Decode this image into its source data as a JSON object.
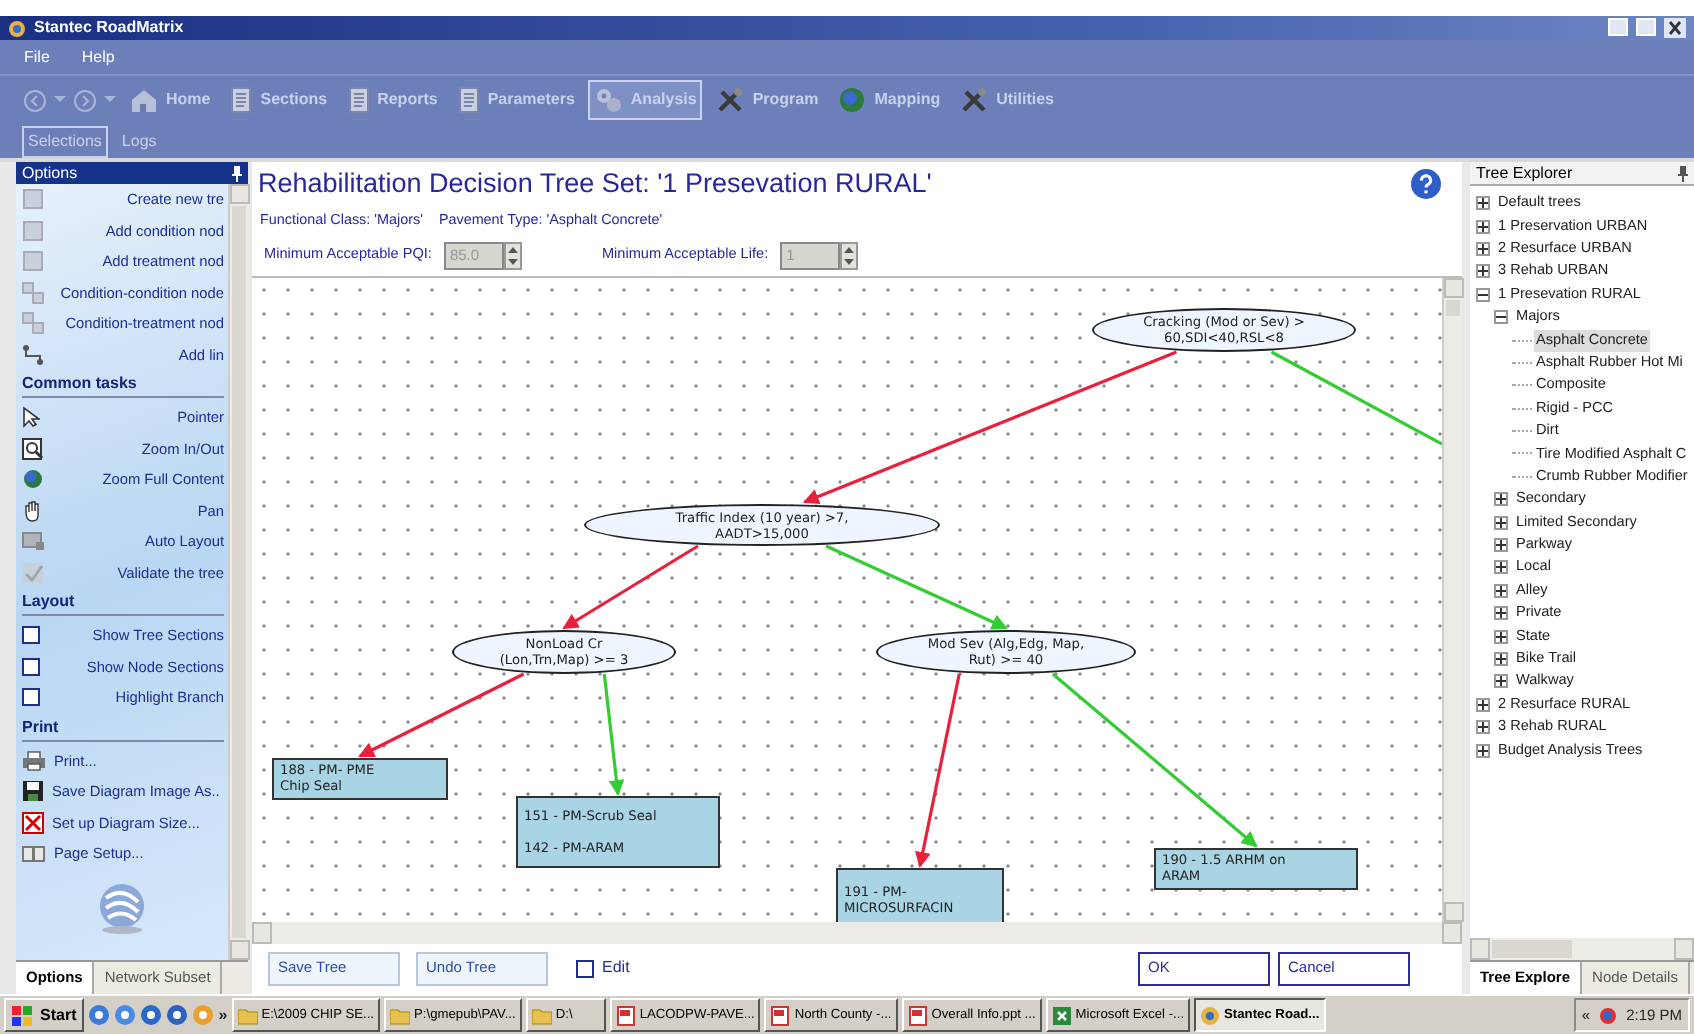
{
  "window": {
    "title": "Stantec RoadMatrix"
  },
  "menu": [
    "File",
    "Help"
  ],
  "toolbar": [
    {
      "label": "Home",
      "kind": "house",
      "selected": false
    },
    {
      "label": "Sections",
      "kind": "doc",
      "selected": false
    },
    {
      "label": "Reports",
      "kind": "doc",
      "selected": false
    },
    {
      "label": "Parameters",
      "kind": "doc",
      "selected": false
    },
    {
      "label": "Analysis",
      "kind": "gears",
      "selected": true
    },
    {
      "label": "Program",
      "kind": "tools",
      "selected": false
    },
    {
      "label": "Mapping",
      "kind": "globe",
      "selected": false
    },
    {
      "label": "Utilities",
      "kind": "tools",
      "selected": false
    }
  ],
  "subtabs": [
    {
      "label": "Selections",
      "selected": true
    },
    {
      "label": "Logs",
      "selected": false
    }
  ],
  "options_panel": {
    "title": "Options",
    "sections": [
      {
        "items": [
          {
            "label": "Create new tre",
            "kind": "tool"
          },
          {
            "label": "Add condition nod",
            "kind": "tool"
          },
          {
            "label": "Add  treatment  nod",
            "kind": "tool"
          },
          {
            "label": "Condition-condition node",
            "kind": "tool"
          },
          {
            "label": "Condition-treatment nod",
            "kind": "tool"
          },
          {
            "label": "Add lin",
            "kind": "tool"
          }
        ]
      },
      {
        "heading": "Common tasks",
        "items": [
          {
            "label": "Pointer",
            "kind": "tool"
          },
          {
            "label": "Zoom In/Out",
            "kind": "tool"
          },
          {
            "label": "Zoom Full Content",
            "kind": "tool"
          },
          {
            "label": "Pan",
            "kind": "tool"
          },
          {
            "label": "Auto Layout",
            "kind": "tool"
          },
          {
            "label": "Validate the tree",
            "kind": "tool"
          }
        ]
      },
      {
        "heading": "Layout",
        "items": [
          {
            "label": "Show Tree Sections",
            "kind": "checkbox",
            "checked": false
          },
          {
            "label": "Show Node  Sections",
            "kind": "checkbox",
            "checked": false
          },
          {
            "label": "Highlight Branch",
            "kind": "checkbox",
            "checked": false
          }
        ]
      },
      {
        "heading": "Print",
        "items": [
          {
            "label": "Print...",
            "kind": "action"
          },
          {
            "label": "Save Diagram Image As..",
            "kind": "action"
          },
          {
            "label": "Set up Diagram Size...",
            "kind": "action"
          },
          {
            "label": "Page Setup...",
            "kind": "action"
          }
        ]
      }
    ]
  },
  "left_tabs": [
    {
      "label": "Options",
      "selected": true
    },
    {
      "label": "Network Subset",
      "selected": false
    }
  ],
  "editor": {
    "heading": "Rehabilitation Decision Tree Set: '1 Presevation RURAL'",
    "functional_class": "Functional Class: 'Majors'",
    "pavement_type": "Pavement Type: 'Asphalt Concrete'",
    "fields": [
      {
        "label": "Minimum Acceptable PQI:",
        "value": "85.0",
        "disabled": true
      },
      {
        "label": "Minimum Acceptable Life:",
        "value": "1",
        "disabled": true
      }
    ],
    "diagram": {
      "nodes": [
        {
          "kind": "condition",
          "text": "Cracking (Mod or Sev) >\n60,SDI<40,RSL<8"
        },
        {
          "kind": "condition",
          "text": "Traffic Index (10 year) >7,\nAADT>15,000"
        },
        {
          "kind": "condition",
          "text": "NonLoad Cr\n(Lon,Trn,Map) >= 3"
        },
        {
          "kind": "condition",
          "text": "Mod Sev (Alg,Edg, Map,\nRut) >= 40"
        },
        {
          "kind": "treatment",
          "treatments": [
            "188 - PM- PME\nChip Seal"
          ]
        },
        {
          "kind": "treatment",
          "treatments": [
            "151 - PM-Scrub Seal",
            "142 - PM-ARAM"
          ]
        },
        {
          "kind": "treatment",
          "treatments": [
            "191 - PM-\nMICROSURFACIN"
          ]
        },
        {
          "kind": "treatment",
          "treatments": [
            "190 - 1.5 ARHM on\nARAM"
          ]
        }
      ],
      "edges": [
        {
          "color": "#e8203c"
        },
        {
          "color": "#33cc33"
        },
        {
          "color": "#e8203c"
        },
        {
          "color": "#33cc33"
        },
        {
          "color": "#e8203c"
        },
        {
          "color": "#33cc33"
        },
        {
          "color": "#e8203c"
        },
        {
          "color": "#33cc33"
        }
      ]
    },
    "buttons": [
      "Save Tree",
      "Undo Tree"
    ],
    "edit": {
      "label": "Edit",
      "checked": false
    },
    "dialog_buttons": [
      "OK",
      "Cancel"
    ]
  },
  "tree_explorer": {
    "title": "Tree Explorer",
    "items": [
      {
        "label": "Default trees",
        "expanded": false,
        "selected": false
      },
      {
        "label": "1 Preservation URBAN",
        "expanded": false,
        "selected": false
      },
      {
        "label": "2 Resurface URBAN",
        "expanded": false,
        "selected": false
      },
      {
        "label": "3 Rehab URBAN",
        "expanded": false,
        "selected": false
      },
      {
        "label": "1 Presevation RURAL",
        "expanded": true,
        "selected": false,
        "children": [
          {
            "label": "Majors",
            "expanded": true,
            "selected": false,
            "children": [
              {
                "label": "Asphalt Concrete",
                "selected": true
              },
              {
                "label": "Asphalt Rubber Hot Mi",
                "selected": false
              },
              {
                "label": "Composite",
                "selected": false
              },
              {
                "label": "Rigid - PCC",
                "selected": false
              },
              {
                "label": "Dirt",
                "selected": false
              },
              {
                "label": "Tire Modified Asphalt C",
                "selected": false
              },
              {
                "label": "Crumb Rubber Modifier",
                "selected": false
              }
            ]
          },
          {
            "label": "Secondary",
            "expanded": false,
            "selected": false
          },
          {
            "label": "Limited Secondary",
            "expanded": false,
            "selected": false
          },
          {
            "label": "Parkway",
            "expanded": false,
            "selected": false
          },
          {
            "label": "Local",
            "expanded": false,
            "selected": false
          },
          {
            "label": "Alley",
            "expanded": false,
            "selected": false
          },
          {
            "label": "Private",
            "expanded": false,
            "selected": false
          },
          {
            "label": "State",
            "expanded": false,
            "selected": false
          },
          {
            "label": "Bike Trail",
            "expanded": false,
            "selected": false
          },
          {
            "label": "Walkway",
            "expanded": false,
            "selected": false
          }
        ]
      },
      {
        "label": "2 Resurface RURAL",
        "expanded": false,
        "selected": false
      },
      {
        "label": "3 Rehab RURAL",
        "expanded": false,
        "selected": false
      },
      {
        "label": "Budget Analysis Trees",
        "expanded": false,
        "selected": false
      }
    ]
  },
  "right_tabs": [
    {
      "label": "Tree Explore",
      "selected": true
    },
    {
      "label": "Node Details",
      "selected": false
    }
  ],
  "taskbar": {
    "start": "Start",
    "overflow": "»",
    "tasks": [
      {
        "label": "E:\\2009 CHIP SE...",
        "kind": "folder",
        "selected": false
      },
      {
        "label": "P:\\gmepub\\PAV...",
        "kind": "folder",
        "selected": false
      },
      {
        "label": "D:\\",
        "kind": "folder",
        "selected": false
      },
      {
        "label": "LACODPW-PAVE...",
        "kind": "document",
        "selected": false
      },
      {
        "label": "North County -...",
        "kind": "document",
        "selected": false
      },
      {
        "label": "Overall Info.ppt ...",
        "kind": "document",
        "selected": false
      },
      {
        "label": "Microsoft Excel -...",
        "kind": "spreadsheet",
        "selected": false
      },
      {
        "label": "Stantec Road...",
        "kind": "app",
        "selected": true
      }
    ],
    "tray_toggle": "«",
    "clock": "2:19 PM"
  }
}
